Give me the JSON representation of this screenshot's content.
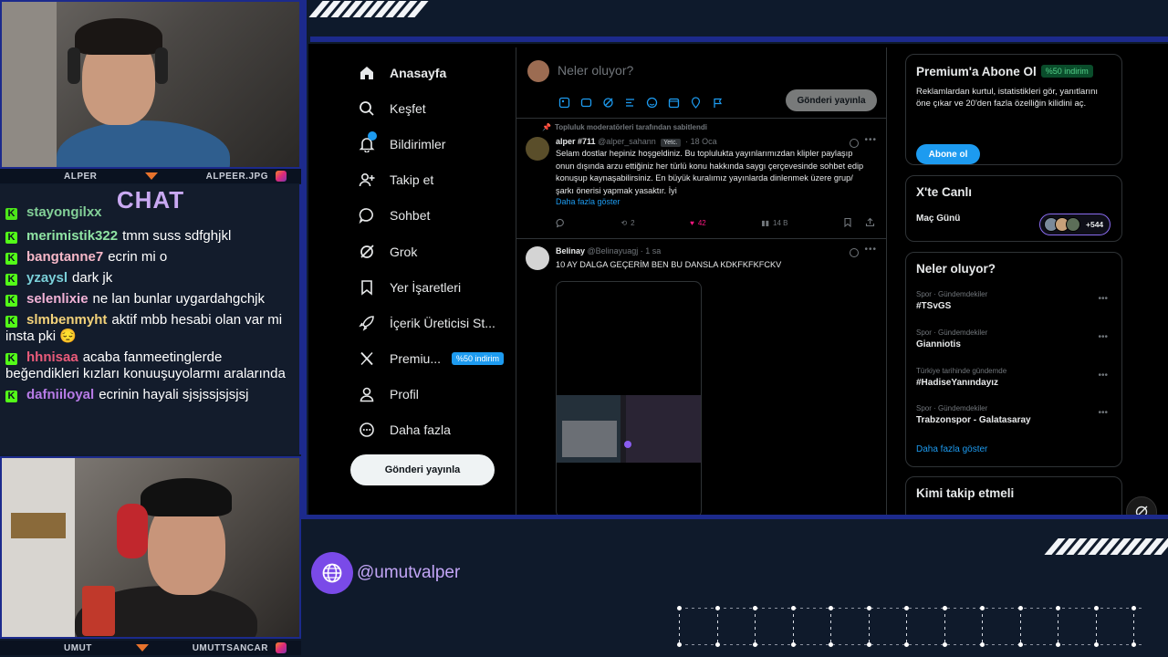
{
  "colors": {
    "overlay_bg": "#0f1a2b",
    "accent_blue": "#1c2a8c",
    "kick_green": "#53fc18",
    "x_blue": "#1d9bf0",
    "chat_title": "#c9a9f2"
  },
  "cam_top": {
    "left_label": "ALPER",
    "right_label": "ALPEER.JPG"
  },
  "cam_bottom": {
    "left_label": "UMUT",
    "right_label": "UMUTTSANCAR"
  },
  "chat": {
    "title": "CHAT",
    "partial_top": "stayongilxx",
    "messages": [
      {
        "user": "merimistik322",
        "color": "#8fe3a3",
        "text": "tmm suss sdfghjkl"
      },
      {
        "user": "bangtanne7",
        "color": "#f7b8c8",
        "text": "ecrin mi o"
      },
      {
        "user": "yzaysl",
        "color": "#7ad0d9",
        "text": "dark jk"
      },
      {
        "user": "selenlixie",
        "color": "#f2b2d6",
        "text": "ne lan bunlar uygardahgchjk"
      },
      {
        "user": "slmbenmyht",
        "color": "#f3d27a",
        "text": "aktif mbb hesabi olan var mi insta pki 😔"
      },
      {
        "user": "hhnisaa",
        "color": "#ea5b7a",
        "text": "acaba fanmeetinglerde beğendikleri kızları konuuşuyolarmı aralarında"
      },
      {
        "user": "dafniiloyal",
        "color": "#b77be6",
        "text": "ecrinin hayali sjsjssjsjsjsj"
      }
    ]
  },
  "x": {
    "nav": [
      {
        "label": "Anasayfa",
        "icon": "home-icon",
        "active": true
      },
      {
        "label": "Keşfet",
        "icon": "search-icon"
      },
      {
        "label": "Bildirimler",
        "icon": "bell-icon",
        "badge": "5"
      },
      {
        "label": "Takip et",
        "icon": "person-plus-icon"
      },
      {
        "label": "Sohbet",
        "icon": "chat-bubble-icon"
      },
      {
        "label": "Grok",
        "icon": "grok-icon"
      },
      {
        "label": "Yer İşaretleri",
        "icon": "bookmark-icon"
      },
      {
        "label": "İçerik Üreticisi St...",
        "icon": "rocket-icon"
      },
      {
        "label": "Premiu...",
        "icon": "x-logo-icon",
        "pill": "%50 indirim"
      },
      {
        "label": "Profil",
        "icon": "person-icon"
      },
      {
        "label": "Daha fazla",
        "icon": "more-circle-icon"
      }
    ],
    "post_button": "Gönderi yayınla",
    "compose": {
      "placeholder": "Neler oluyor?",
      "button": "Gönderi yayınla"
    },
    "tweets": [
      {
        "pinned_text": "Topluluk moderatörleri tarafından sabitlendi",
        "name": "alper #711",
        "handle": "@alper_sahann",
        "role": "Yetc.",
        "date": "18 Oca",
        "text": "Selam dostlar hepiniz hoşgeldiniz. Bu toplulukta yayınlarımızdan klipler paylaşıp onun dışında arzu ettiğiniz her türlü konu hakkında saygı çerçevesinde sohbet edip konuşup kaynaşabilirsiniz. En büyük kuralımız yayınlarda dinlenmek üzere grup/şarkı önerisi yapmak yasaktır. İyi",
        "show_more": "Daha fazla göster",
        "retweets": "2",
        "likes": "42",
        "views": "14 B"
      },
      {
        "name": "Belinay",
        "handle": "@Belinayuagj",
        "date": "1 sa",
        "text": "10 AY DALGA GEÇERİM BEN BU DANSLA KDKFKFKFCKV"
      }
    ],
    "premium_card": {
      "title": "Premium'a Abone Ol",
      "pill": "%50 indirim",
      "text": "Reklamlardan kurtul, istatistikleri gör, yanıtlarını öne çıkar ve 20'den fazla özelliğin kilidini aç.",
      "button": "Abone ol"
    },
    "live_card": {
      "title": "X'te Canlı",
      "item": "Maç Günü",
      "count": "+544"
    },
    "trends_card": {
      "title": "Neler oluyor?",
      "items": [
        {
          "category": "Spor · Gündemdekiler",
          "name": "#TSvGS"
        },
        {
          "category": "Spor · Gündemdekiler",
          "name": "Gianniotis"
        },
        {
          "category": "Türkiye tarihinde gündemde",
          "name": "#HadiseYanındayız"
        },
        {
          "category": "Spor · Gündemdekiler",
          "name": "Trabzonspor - Galatasaray"
        }
      ],
      "show_more": "Daha fazla göster"
    },
    "follow_card": {
      "title": "Kimi takip etmeli"
    }
  },
  "handle": "@umutvalper"
}
